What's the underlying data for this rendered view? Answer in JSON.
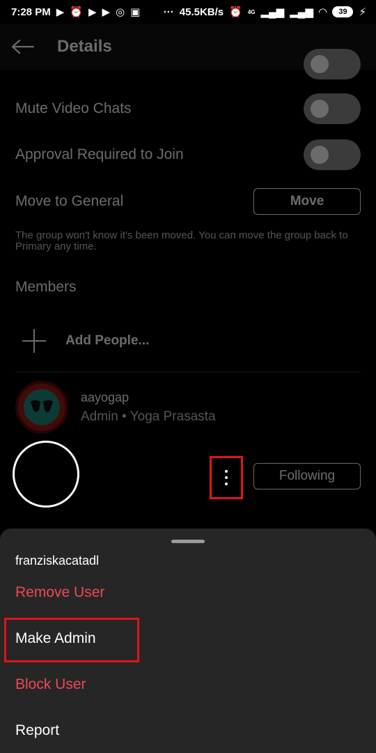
{
  "status_bar": {
    "time": "7:28 PM",
    "network_speed": "45.5KB/s",
    "network_type": "4G",
    "battery": "39",
    "icons_left": [
      "play-icon",
      "alarm-icon",
      "play-icon",
      "play-icon",
      "instagram-icon",
      "shopping-icon",
      "more-dots-icon"
    ],
    "icons_right": [
      "alarm-icon",
      "signal-icon",
      "signal-icon",
      "wifi-icon",
      "battery-icon",
      "charging-icon"
    ]
  },
  "appbar": {
    "title": "Details"
  },
  "settings": {
    "mute_video_chats": {
      "label": "Mute Video Chats",
      "on": false
    },
    "approval_required": {
      "label": "Approval Required to Join",
      "on": false
    },
    "move_to_general": {
      "label": "Move to General",
      "button_label": "Move"
    },
    "move_note": "The group won't know it's been moved. You can move the group back to Primary any time."
  },
  "members": {
    "section_title": "Members",
    "add_people_label": "Add People...",
    "list": [
      {
        "username": "aayogap",
        "subtitle": "Admin • Yoga Prasasta"
      }
    ],
    "following_label": "Following"
  },
  "sheet": {
    "username": "franziskacatadl",
    "remove_user": "Remove User",
    "make_admin": "Make Admin",
    "block_user": "Block User",
    "report": "Report"
  },
  "colors": {
    "background": "#000000",
    "sheet": "#262626",
    "danger": "#ed4956",
    "highlight": "#e0141c",
    "avatar_red": "#a01818",
    "avatar_teal": "#1e8a80"
  }
}
